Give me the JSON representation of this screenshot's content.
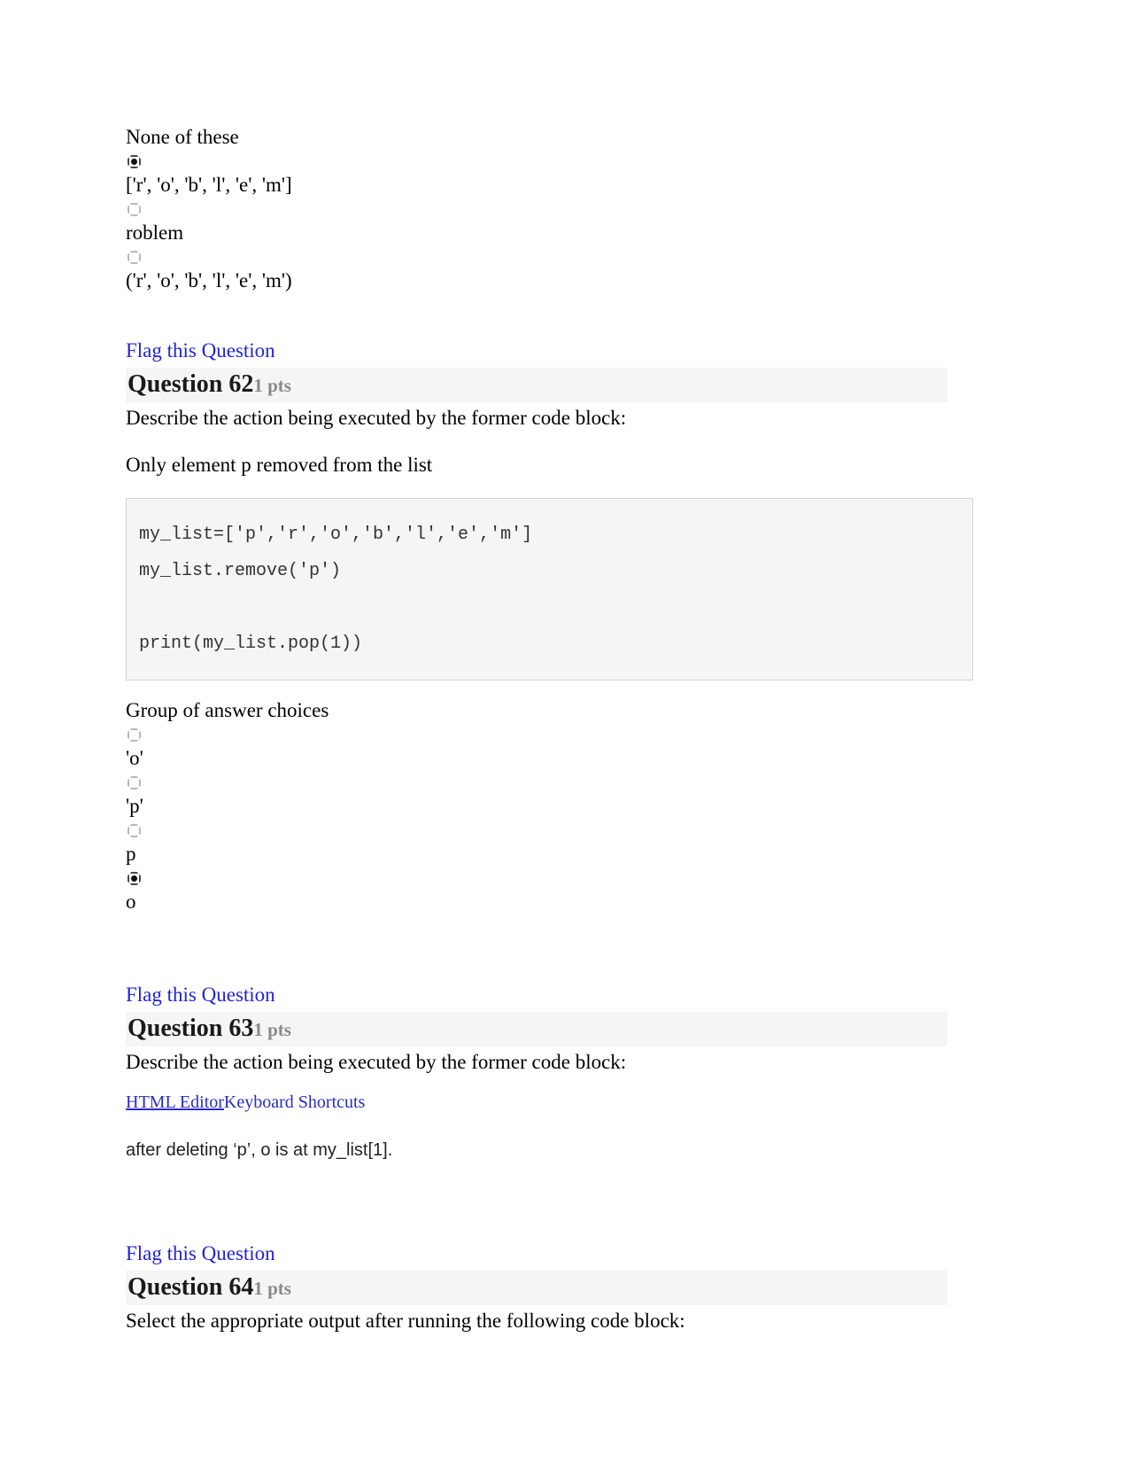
{
  "top_options": {
    "lead_label": "None of these",
    "items": [
      {
        "selected": true,
        "label": "['r', 'o', 'b', 'l', 'e', 'm']"
      },
      {
        "selected": false,
        "label": "roblem"
      },
      {
        "selected": false,
        "label": "('r', 'o', 'b', 'l', 'e', 'm')"
      }
    ]
  },
  "questions": [
    {
      "flag_label": "Flag this Question",
      "title": "Question 62",
      "points": "1 pts",
      "prompt": "Describe the action being executed by the former code block:",
      "subtext": "Only element p removed from the list",
      "code_lines": [
        "my_list=['p','r','o','b','l','e','m']",
        "my_list.remove('p')",
        "",
        "print(my_list.pop(1))"
      ],
      "choices_label": "Group of answer choices",
      "choices": [
        {
          "selected": false,
          "label": "'o'"
        },
        {
          "selected": false,
          "label": "'p'"
        },
        {
          "selected": false,
          "label": "p"
        },
        {
          "selected": true,
          "label": "o"
        }
      ]
    },
    {
      "flag_label": "Flag this Question",
      "title": "Question 63",
      "points": "1 pts",
      "prompt": "Describe the action being executed by the former code block:",
      "editor_link": "HTML Editor",
      "editor_shortcuts": "Keyboard Shortcuts",
      "answer_text": "after deleting ‘p’, o is at my_list[1]."
    },
    {
      "flag_label": "Flag this Question",
      "title": "Question 64",
      "points": "1 pts",
      "prompt": "Select the appropriate output after running the following code block:"
    }
  ]
}
